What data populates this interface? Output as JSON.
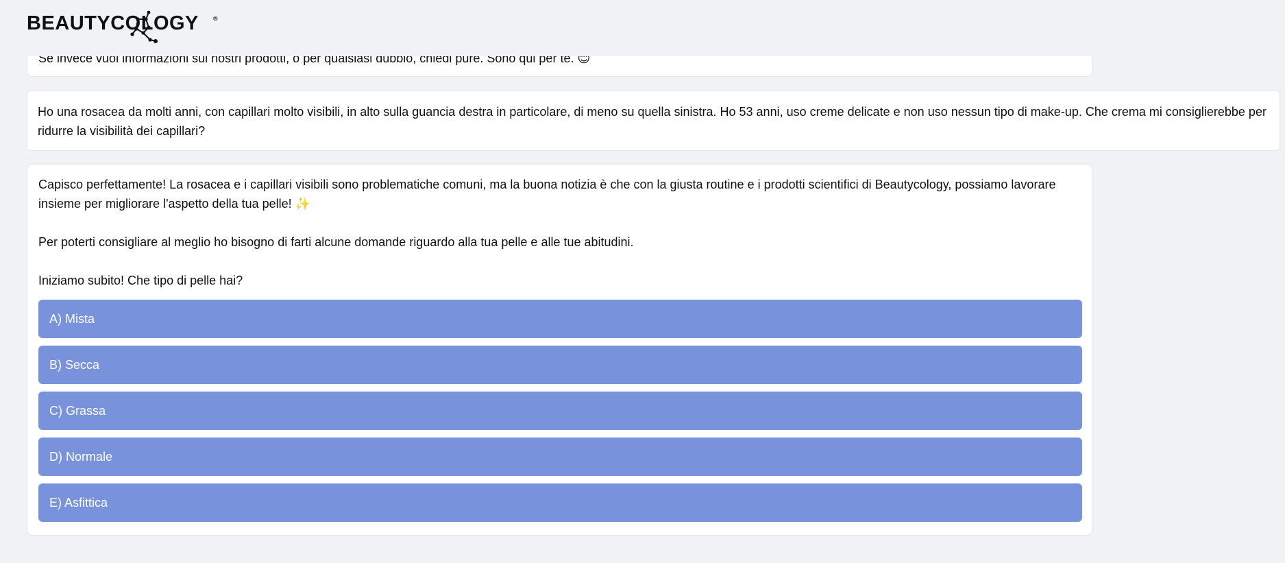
{
  "header": {
    "logo_text": "BEAUTYCOLOGY",
    "logo_reg": "®"
  },
  "chat": {
    "previous_message": "Se invece vuoi informazioni sui nostri prodotti, o per qualsiasi dubbio, chiedi pure. Sono qui per te. 😊",
    "user_message": "Ho una rosacea da molti anni, con capillari molto visibili, in alto sulla guancia destra in particolare, di meno su quella sinistra. Ho 53 anni, uso creme delicate e non uso nessun tipo di make-up. Che crema mi consiglierebbe per ridurre la visibilità dei capillari?",
    "bot_message": {
      "paragraph_1": "Capisco perfettamente! La rosacea e i capillari visibili sono problematiche comuni, ma la buona notizia è che con la giusta routine e i prodotti scientifici di Beautycology, possiamo lavorare insieme per migliorare l'aspetto della tua pelle! ✨",
      "paragraph_2": "Per poterti consigliare al meglio ho bisogno di farti alcune domande riguardo alla tua pelle e alle tue abitudini.",
      "paragraph_3": "Iniziamo subito! Che tipo di pelle hai?"
    },
    "options": [
      {
        "label": "A) Mista"
      },
      {
        "label": "B) Secca"
      },
      {
        "label": "C) Grassa"
      },
      {
        "label": "D) Normale"
      },
      {
        "label": "E) Asfittica"
      }
    ]
  },
  "colors": {
    "background": "#f1f2f6",
    "bubble": "#ffffff",
    "option_button": "#7892dc",
    "option_text": "#ffffff"
  }
}
